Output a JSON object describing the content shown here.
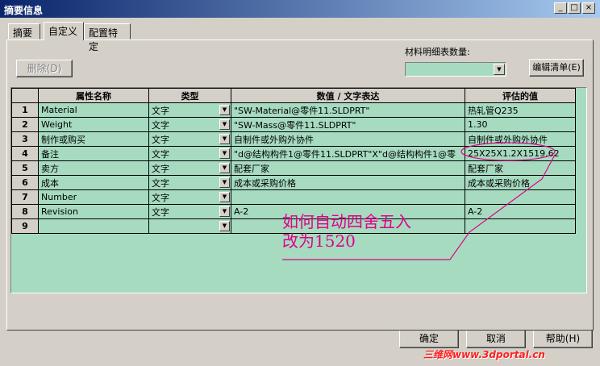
{
  "window": {
    "title": "摘要信息",
    "min_glyph": "_",
    "max_glyph": "□",
    "close_glyph": "×"
  },
  "tabs": [
    {
      "label": "摘要"
    },
    {
      "label": "自定义"
    },
    {
      "label": "配置特定"
    }
  ],
  "toolbar": {
    "delete_label": "删除(D)",
    "bom_qty_label": "材料明细表数量:",
    "bom_qty_value": "",
    "edit_list_label": "编辑清单(E)"
  },
  "grid": {
    "columns": [
      "",
      "属性名称",
      "类型",
      "数值 / 文字表达",
      "评估的值"
    ],
    "rows": [
      {
        "num": "1",
        "name": "Material",
        "type": "文字",
        "value": "\"SW-Material@零件11.SLDPRT\"",
        "evaluated": "热轧管Q235"
      },
      {
        "num": "2",
        "name": "Weight",
        "type": "文字",
        "value": "\"SW-Mass@零件11.SLDPRT\"",
        "evaluated": "1.30"
      },
      {
        "num": "3",
        "name": "制作或购买",
        "type": "文字",
        "value": "自制件或外购外协件",
        "evaluated": "自制件或外购外协件"
      },
      {
        "num": "4",
        "name": "备注",
        "type": "文字",
        "value": "\"d@结构构件1@零件11.SLDPRT\"X\"d@结构构件1@零",
        "evaluated": "25X25X1.2X1519.62"
      },
      {
        "num": "5",
        "name": "卖方",
        "type": "文字",
        "value": "配套厂家",
        "evaluated": "配套厂家"
      },
      {
        "num": "6",
        "name": "成本",
        "type": "文字",
        "value": "成本或采购价格",
        "evaluated": "成本或采购价格"
      },
      {
        "num": "7",
        "name": "Number",
        "type": "文字",
        "value": "",
        "evaluated": ""
      },
      {
        "num": "8",
        "name": "Revision",
        "type": "文字",
        "value": "A-2",
        "evaluated": "A-2"
      },
      {
        "num": "9",
        "name": "",
        "type": "",
        "value": "",
        "evaluated": ""
      }
    ]
  },
  "annotation": {
    "line1": "如何自动四舍五入",
    "line2": "改为1520",
    "color": "#e0008a"
  },
  "buttons": {
    "ok": "确定",
    "cancel": "取消",
    "help": "帮助(H)"
  },
  "watermark": "三维网www.3dportal.cn",
  "colors": {
    "grid_bg": "#a6dbc0",
    "titlebar": "#0a246a",
    "dialog_bg": "#d4d0c8"
  }
}
